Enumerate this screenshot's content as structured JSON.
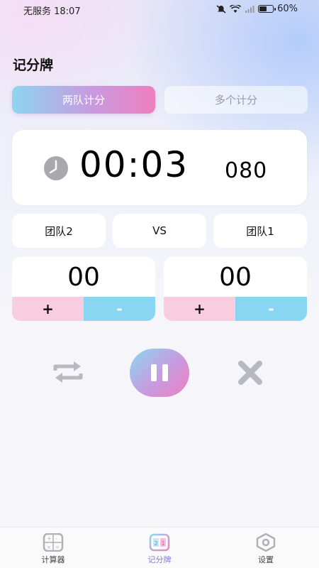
{
  "status_bar": {
    "carrier_time": "无服务 18:07",
    "battery_text": "60%",
    "battery_level": 0.6,
    "icons": [
      "bell-off-icon",
      "wifi-icon",
      "signal-icon",
      "battery-icon"
    ]
  },
  "page": {
    "title": "记分牌"
  },
  "mode_tabs": [
    {
      "label": "两队计分",
      "active": true
    },
    {
      "label": "多个计分",
      "active": false
    }
  ],
  "timer": {
    "main": "00:03",
    "ms": "080",
    "icon": "clock-icon"
  },
  "teams": {
    "left_name": "团队2",
    "vs": "VS",
    "right_name": "团队1"
  },
  "scores": {
    "left": {
      "value": "00",
      "plus": "+",
      "minus": "-"
    },
    "right": {
      "value": "00",
      "plus": "+",
      "minus": "-"
    }
  },
  "controls": {
    "reset_icon": "repeat-icon",
    "pause_icon": "pause-icon",
    "close_icon": "close-icon"
  },
  "bottom_nav": [
    {
      "label": "计算器",
      "icon": "calculator-icon",
      "active": false
    },
    {
      "label": "记分牌",
      "icon": "scoreboard-icon",
      "active": true
    },
    {
      "label": "设置",
      "icon": "settings-icon",
      "active": false
    }
  ],
  "colors": {
    "accent_blue": "#89d6f2",
    "accent_pink": "#f8cde0",
    "accent_purple": "#8a7ad8"
  }
}
